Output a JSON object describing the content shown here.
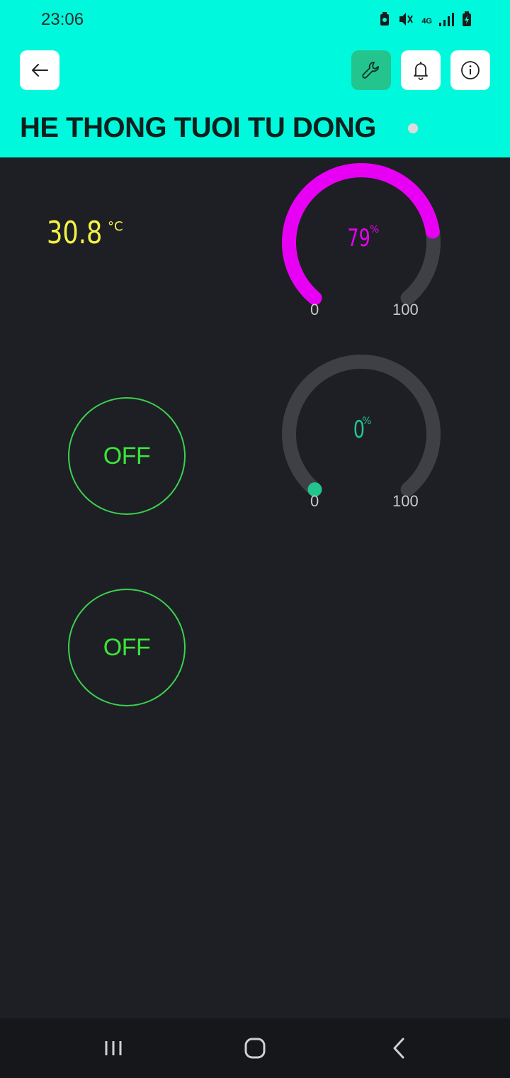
{
  "status_bar": {
    "time": "23:06",
    "network": "4G"
  },
  "header": {
    "title": "HE THONG TUOI TU DONG",
    "icons": [
      "back-arrow-icon",
      "wrench-icon",
      "bell-icon",
      "info-icon"
    ],
    "background_color": "#00f9dc",
    "active_button_color": "#23c48e"
  },
  "temperature": {
    "value": "30.8",
    "unit": "°C",
    "color": "#f3f245"
  },
  "gauges": [
    {
      "value": 79,
      "value_text": "79",
      "unit": "%",
      "min": "0",
      "max": "100",
      "color": "#e800f5"
    },
    {
      "value": 0,
      "value_text": "0",
      "unit": "%",
      "min": "0",
      "max": "100",
      "color": "#23c48e"
    }
  ],
  "toggles": [
    {
      "label": "OFF",
      "color": "#3be43b"
    },
    {
      "label": "OFF",
      "color": "#3be43b"
    }
  ],
  "nav_bar": {
    "icons": [
      "recent-apps-icon",
      "home-icon",
      "back-icon"
    ]
  }
}
